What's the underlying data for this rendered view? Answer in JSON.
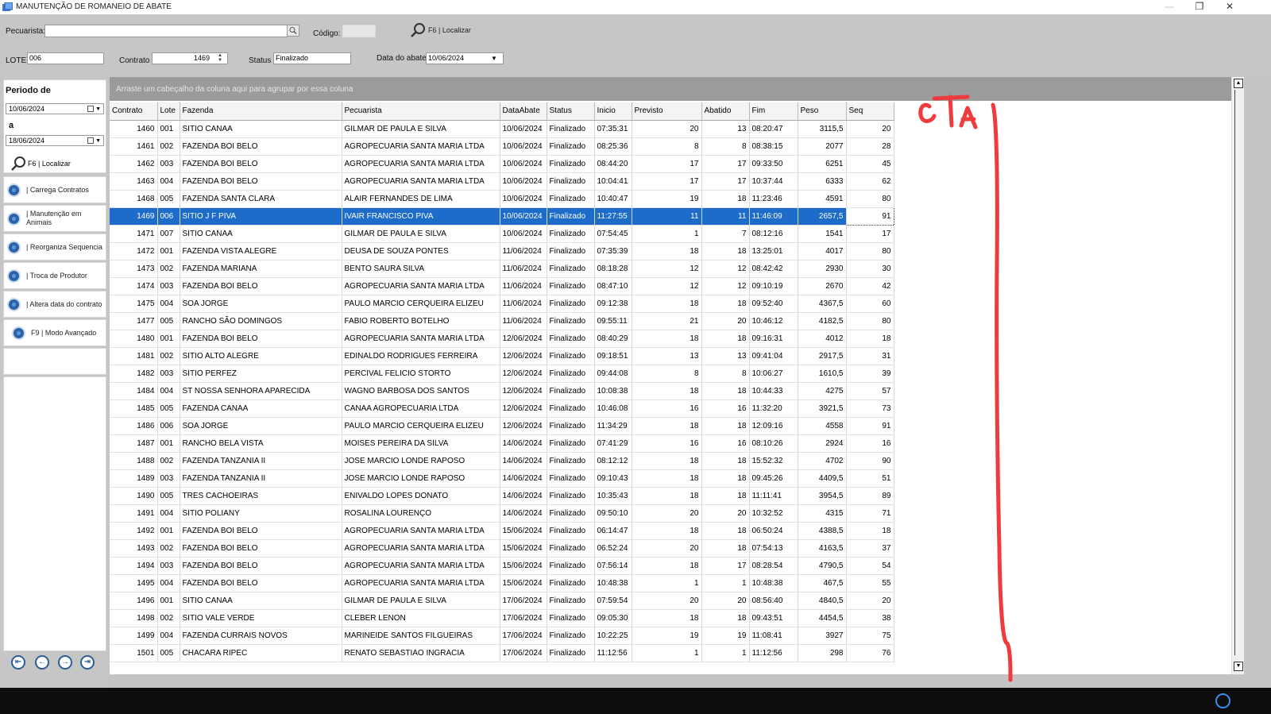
{
  "window": {
    "title": "MANUTENÇÃO DE ROMANEIO DE ABATE",
    "restore_glyph": "❐",
    "close_glyph": "✕",
    "minimize_glyph": "—"
  },
  "filters": {
    "pecuarista_label": "Pecuarista:",
    "pecuarista_value": "",
    "codigo_label": "Código:",
    "codigo_value": "",
    "locate_label": "F6 | Localizar",
    "lote_label": "LOTE",
    "lote_value": "006",
    "contrato_label": "Contrato",
    "contrato_value": "1469",
    "status_label": "Status",
    "status_value": "Finalizado",
    "data_abate_label": "Data do abate",
    "data_abate_value": "10/06/2024"
  },
  "left_panel": {
    "periodo_label": "Periodo de",
    "date_from": "10/06/2024",
    "a_label": "a",
    "date_to": "18/06/2024",
    "locate_label": "F6 | Localizar",
    "actions": [
      {
        "label": "| Carrega Contratos"
      },
      {
        "label": "| Manutenção em Animais"
      },
      {
        "label": "| Reorganiza Sequencia"
      },
      {
        "label": "| Troca de Produtor"
      },
      {
        "label": "| Altera data do contrato"
      },
      {
        "label": "F9 | Modo Avançado"
      }
    ]
  },
  "grid": {
    "group_hint": "Arraste um cabeçalho da coluna aqui para agrupar por essa coluna",
    "columns": [
      "Contrato",
      "Lote",
      "Fazenda",
      "Pecuarista",
      "DataAbate",
      "Status",
      "Inicio",
      "Previsto",
      "Abatido",
      "Fim",
      "Peso",
      "Seq"
    ],
    "selected_row": 5,
    "rows": [
      [
        "1460",
        "001",
        "SITIO CANAA",
        "GILMAR DE PAULA E SILVA",
        "10/06/2024",
        "Finalizado",
        "07:35:31",
        "20",
        "13",
        "08:20:47",
        "3115,5",
        "20"
      ],
      [
        "1461",
        "002",
        "FAZENDA BOI BELO",
        "AGROPECUARIA SANTA MARIA LTDA",
        "10/06/2024",
        "Finalizado",
        "08:25:36",
        "8",
        "8",
        "08:38:15",
        "2077",
        "28"
      ],
      [
        "1462",
        "003",
        "FAZENDA BOI BELO",
        "AGROPECUARIA SANTA MARIA LTDA",
        "10/06/2024",
        "Finalizado",
        "08:44:20",
        "17",
        "17",
        "09:33:50",
        "6251",
        "45"
      ],
      [
        "1463",
        "004",
        "FAZENDA BOI BELO",
        "AGROPECUARIA SANTA MARIA LTDA",
        "10/06/2024",
        "Finalizado",
        "10:04:41",
        "17",
        "17",
        "10:37:44",
        "6333",
        "62"
      ],
      [
        "1468",
        "005",
        "FAZENDA SANTA CLARA",
        "ALAIR FERNANDES DE LIMA",
        "10/06/2024",
        "Finalizado",
        "10:40:47",
        "19",
        "18",
        "11:23:46",
        "4591",
        "80"
      ],
      [
        "1469",
        "006",
        "SITIO J F PIVA",
        "IVAIR FRANCISCO PIVA",
        "10/06/2024",
        "Finalizado",
        "11:27:55",
        "11",
        "11",
        "11:46:09",
        "2657,5",
        "91"
      ],
      [
        "1471",
        "007",
        "SITIO CANAA",
        "GILMAR DE PAULA E SILVA",
        "10/06/2024",
        "Finalizado",
        "07:54:45",
        "1",
        "7",
        "08:12:16",
        "1541",
        "17"
      ],
      [
        "1472",
        "001",
        "FAZENDA VISTA ALEGRE",
        "DEUSA DE SOUZA PONTES",
        "11/06/2024",
        "Finalizado",
        "07:35:39",
        "18",
        "18",
        "13:25:01",
        "4017",
        "80"
      ],
      [
        "1473",
        "002",
        "FAZENDA MARIANA",
        "BENTO SAURA SILVA",
        "11/06/2024",
        "Finalizado",
        "08:18:28",
        "12",
        "12",
        "08:42:42",
        "2930",
        "30"
      ],
      [
        "1474",
        "003",
        "FAZENDA BOI BELO",
        "AGROPECUARIA SANTA MARIA LTDA",
        "11/06/2024",
        "Finalizado",
        "08:47:10",
        "12",
        "12",
        "09:10:19",
        "2670",
        "42"
      ],
      [
        "1475",
        "004",
        "SOA JORGE",
        "PAULO MARCIO CERQUEIRA ELIZEU",
        "11/06/2024",
        "Finalizado",
        "09:12:38",
        "18",
        "18",
        "09:52:40",
        "4367,5",
        "60"
      ],
      [
        "1477",
        "005",
        "RANCHO SÃO DOMINGOS",
        "FABIO ROBERTO BOTELHO",
        "11/06/2024",
        "Finalizado",
        "09:55:11",
        "21",
        "20",
        "10:46:12",
        "4182,5",
        "80"
      ],
      [
        "1480",
        "001",
        "FAZENDA BOI BELO",
        "AGROPECUARIA SANTA MARIA LTDA",
        "12/06/2024",
        "Finalizado",
        "08:40:29",
        "18",
        "18",
        "09:16:31",
        "4012",
        "18"
      ],
      [
        "1481",
        "002",
        "SITIO ALTO ALEGRE",
        "EDINALDO RODRIGUES FERREIRA",
        "12/06/2024",
        "Finalizado",
        "09:18:51",
        "13",
        "13",
        "09:41:04",
        "2917,5",
        "31"
      ],
      [
        "1482",
        "003",
        "SITIO PERFEZ",
        "PERCIVAL FELICIO STORTO",
        "12/06/2024",
        "Finalizado",
        "09:44:08",
        "8",
        "8",
        "10:06:27",
        "1610,5",
        "39"
      ],
      [
        "1484",
        "004",
        "ST NOSSA SENHORA APARECIDA",
        "WAGNO BARBOSA DOS SANTOS",
        "12/06/2024",
        "Finalizado",
        "10:08:38",
        "18",
        "18",
        "10:44:33",
        "4275",
        "57"
      ],
      [
        "1485",
        "005",
        "FAZENDA CANAA",
        "CANAA AGROPECUARIA LTDA",
        "12/06/2024",
        "Finalizado",
        "10:46:08",
        "16",
        "16",
        "11:32:20",
        "3921,5",
        "73"
      ],
      [
        "1486",
        "006",
        "SOA JORGE",
        "PAULO MARCIO CERQUEIRA ELIZEU",
        "12/06/2024",
        "Finalizado",
        "11:34:29",
        "18",
        "18",
        "12:09:16",
        "4558",
        "91"
      ],
      [
        "1487",
        "001",
        "RANCHO BELA VISTA",
        "MOISES PEREIRA DA SILVA",
        "14/06/2024",
        "Finalizado",
        "07:41:29",
        "16",
        "16",
        "08:10:26",
        "2924",
        "16"
      ],
      [
        "1488",
        "002",
        "FAZENDA TANZANIA II",
        "JOSE MARCIO LONDE RAPOSO",
        "14/06/2024",
        "Finalizado",
        "08:12:12",
        "18",
        "18",
        "15:52:32",
        "4702",
        "90"
      ],
      [
        "1489",
        "003",
        "FAZENDA TANZANIA II",
        "JOSE MARCIO LONDE RAPOSO",
        "14/06/2024",
        "Finalizado",
        "09:10:43",
        "18",
        "18",
        "09:45:26",
        "4409,5",
        "51"
      ],
      [
        "1490",
        "005",
        "TRES CACHOEIRAS",
        "ENIVALDO LOPES DONATO",
        "14/06/2024",
        "Finalizado",
        "10:35:43",
        "18",
        "18",
        "11:11:41",
        "3954,5",
        "89"
      ],
      [
        "1491",
        "004",
        "SITIO POLIANY",
        "ROSALINA LOURENÇO",
        "14/06/2024",
        "Finalizado",
        "09:50:10",
        "20",
        "20",
        "10:32:52",
        "4315",
        "71"
      ],
      [
        "1492",
        "001",
        "FAZENDA BOI BELO",
        "AGROPECUARIA SANTA MARIA LTDA",
        "15/06/2024",
        "Finalizado",
        "06:14:47",
        "18",
        "18",
        "06:50:24",
        "4388,5",
        "18"
      ],
      [
        "1493",
        "002",
        "FAZENDA BOI BELO",
        "AGROPECUARIA SANTA MARIA LTDA",
        "15/06/2024",
        "Finalizado",
        "06:52:24",
        "20",
        "18",
        "07:54:13",
        "4163,5",
        "37"
      ],
      [
        "1494",
        "003",
        "FAZENDA BOI BELO",
        "AGROPECUARIA SANTA MARIA LTDA",
        "15/06/2024",
        "Finalizado",
        "07:56:14",
        "18",
        "17",
        "08:28:54",
        "4790,5",
        "54"
      ],
      [
        "1495",
        "004",
        "FAZENDA BOI BELO",
        "AGROPECUARIA SANTA MARIA LTDA",
        "15/06/2024",
        "Finalizado",
        "10:48:38",
        "1",
        "1",
        "10:48:38",
        "467,5",
        "55"
      ],
      [
        "1496",
        "001",
        "SITIO CANAA",
        "GILMAR DE PAULA E SILVA",
        "17/06/2024",
        "Finalizado",
        "07:59:54",
        "20",
        "20",
        "08:56:40",
        "4840,5",
        "20"
      ],
      [
        "1498",
        "002",
        "SITIO VALE VERDE",
        "CLEBER LENON",
        "17/06/2024",
        "Finalizado",
        "09:05:30",
        "18",
        "18",
        "09:43:51",
        "4454,5",
        "38"
      ],
      [
        "1499",
        "004",
        "FAZENDA CURRAIS NOVOS",
        "MARINEIDE SANTOS FILGUEIRAS",
        "17/06/2024",
        "Finalizado",
        "10:22:25",
        "19",
        "19",
        "11:08:41",
        "3927",
        "75"
      ],
      [
        "1501",
        "005",
        "CHACARA RIPEC",
        "RENATO SEBASTIAO INGRACIA",
        "17/06/2024",
        "Finalizado",
        "11:12:56",
        "1",
        "1",
        "11:12:56",
        "298",
        "76"
      ]
    ]
  },
  "colors": {
    "selection": "#1d6cc9",
    "annotation": "#ef3b3b",
    "taskbar": "#0d0d0d"
  }
}
